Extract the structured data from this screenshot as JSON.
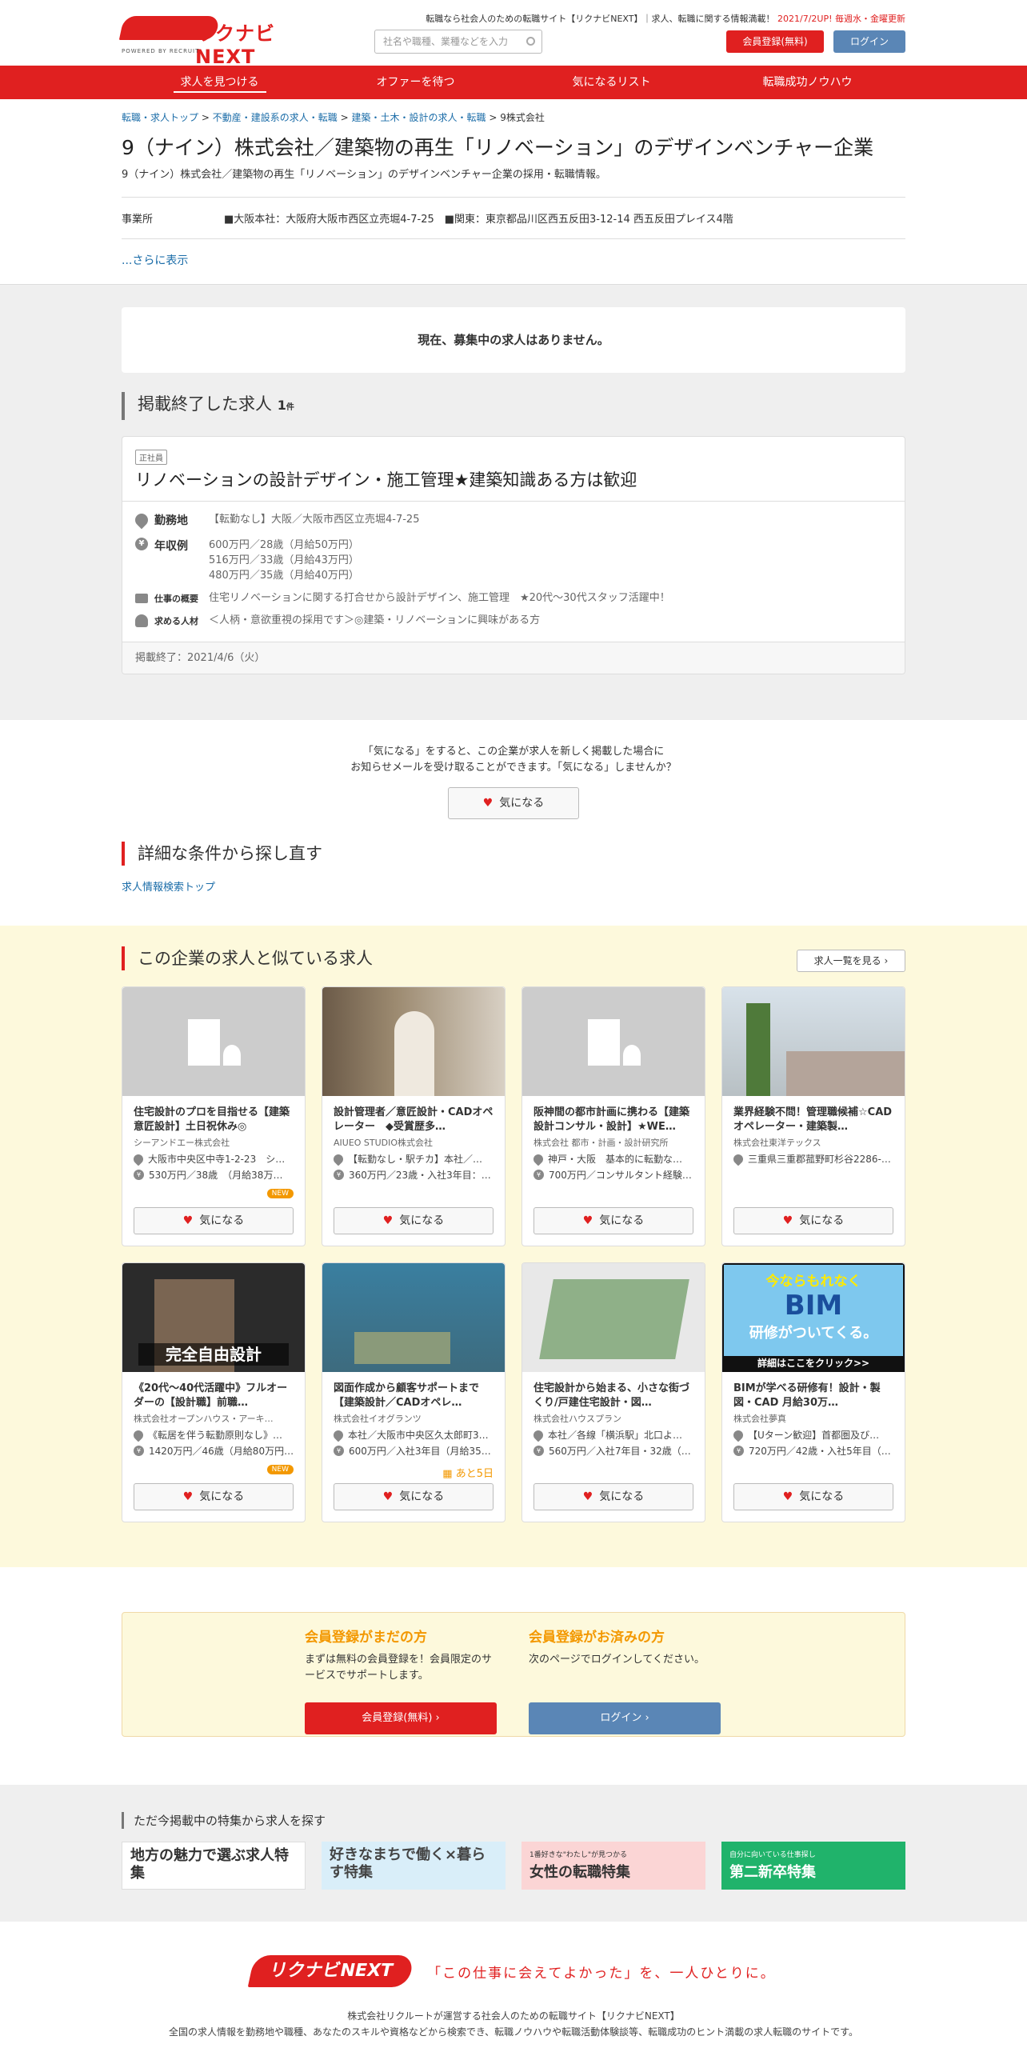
{
  "header": {
    "logo": "リクナビNEXT",
    "powered": "POWERED BY RECRUIT",
    "tagline_pre": "転職なら社会人のための転職サイト【リクナビNEXT】｜求人、転職に関する情報満載！",
    "tagline_red": "2021/7/2UP! 毎週水・金曜更新",
    "search_placeholder": "社名や職種、業種などを入力",
    "register": "会員登録(無料)",
    "login": "ログイン"
  },
  "nav": [
    "求人を見つける",
    "オファーを待つ",
    "気になるリスト",
    "転職成功ノウハウ"
  ],
  "breadcrumb": {
    "c1": "転職・求人トップ",
    "c2": "不動産・建設系の求人・転職",
    "c3": "建築・土木・設計の求人・転職",
    "sep": ">",
    "current": "9株式会社"
  },
  "company": {
    "title": "9（ナイン）株式会社／建築物の再生「リノベーション」のデザインベンチャー企業",
    "subtitle": "9（ナイン）株式会社／建築物の再生「リノベーション」のデザインベンチャー企業の採用・転職情報。",
    "office_label": "事業所",
    "office_value": "■大阪本社：大阪府大阪市西区立売堀4-7-25　■関東：東京都品川区西五反田3-12-14 西五反田プレイス4階",
    "more": "...さらに表示"
  },
  "status": {
    "no_jobs": "現在、募集中の求人はありません。"
  },
  "ended": {
    "heading": "掲載終了した求人",
    "count": "1",
    "count_unit": "件",
    "tag": "正社員",
    "title": "リノベーションの設計デザイン・施工管理★建築知識ある方は歓迎",
    "loc_label": "勤務地",
    "loc": "【転勤なし】大阪／大阪市西区立売堀4-7-25",
    "salary_label": "年収例",
    "salary1": "600万円／28歳（月給50万円）",
    "salary2": "516万円／33歳（月給43万円）",
    "salary3": "480万円／35歳（月給40万円）",
    "summary_label": "仕事の概要",
    "summary": "住宅リノベーションに関する打合せから設計デザイン、施工管理　★20代～30代スタッフ活躍中！",
    "person_label": "求める人材",
    "person": "＜人柄・意欲重視の採用です＞◎建築・リノベーションに興味がある方",
    "end_date": "掲載終了：2021/4/6（火）"
  },
  "kininaru": {
    "text1": "「気になる」をすると、この企業が求人を新しく掲載した場合に",
    "text2": "お知らせメールを受け取ることができます。「気になる」しませんか？",
    "button": "気になる"
  },
  "research": {
    "heading": "詳細な条件から探し直す",
    "link": "求人情報検索トップ"
  },
  "similar": {
    "heading": "この企業の求人と似ている求人",
    "see_all": "求人一覧を見る",
    "kb": "気になる",
    "jobs": [
      {
        "title": "住宅設計のプロを目指せる【建築意匠設計】土日祝休み◎",
        "co": "シーアンドエー株式会社",
        "loc": "大阪市中央区中寺1-2-23　シ…",
        "sal": "530万円／38歳　（月給38万…",
        "badge": "NEW"
      },
      {
        "title": "設計管理者／意匠設計・CADオペレーター　◆受賞歴多…",
        "co": "AIUEO STUDIO株式会社",
        "loc": "【転勤なし・駅チカ】本社／…",
        "sal": "360万円／23歳・入社3年目：…",
        "badge": ""
      },
      {
        "title": "阪神間の都市計画に携わる【建築設計コンサル・設計】★WE…",
        "co": "株式会社 都市・計画・設計研究所",
        "loc": "神戸・大阪　基本的に転勤な…",
        "sal": "700万円／コンサルタント経験…",
        "badge": ""
      },
      {
        "title": "業界経験不問！管理職候補☆CADオペレーター・建築製…",
        "co": "株式会社東洋テックス",
        "loc": "三重県三重郡菰野町杉谷2286-…",
        "sal": "",
        "badge": ""
      },
      {
        "title": "《20代～40代活躍中》フルオーダーの【設計職】前職…",
        "co": "株式会社オープンハウス・アーキ…",
        "loc": "《転居を伴う転勤原則なし》…",
        "sal": "1420万円／46歳（月給80万円…",
        "badge": "NEW"
      },
      {
        "title": "図面作成から顧客サポートまで【建築設計／CADオペレ…",
        "co": "株式会社イオグランツ",
        "loc": "本社／大阪市中央区久太郎町3…",
        "sal": "600万円／入社3年目（月給35…",
        "badge": "あと5日"
      },
      {
        "title": "住宅設計から始まる、小さな街づくり/戸建住宅設計・図…",
        "co": "株式会社ハウスプラン",
        "loc": "本社／各線「横浜駅」北口よ…",
        "sal": "560万円／入社7年目・32歳（…",
        "badge": ""
      },
      {
        "title": "BIMが学べる研修有！設計・製図・CAD 月給30万…",
        "co": "株式会社夢真",
        "loc": "【Uターン歓迎】首都圏及び…",
        "sal": "720万円／42歳・入社5年目（…",
        "badge": ""
      }
    ],
    "img_texts": {
      "design": "完全自由設計",
      "bim1": "今ならもれなく",
      "bim2": "BIM",
      "bim3": "研修がついてくる。",
      "bim4": "詳細はここをクリック>>"
    }
  },
  "member": {
    "h1": "会員登録がまだの方",
    "p1": "まずは無料の会員登録を！会員限定のサービスでサポートします。",
    "b1": "会員登録(無料)",
    "h2": "会員登録がお済みの方",
    "p2": "次のページでログインしてください。",
    "b2": "ログイン"
  },
  "feature": {
    "heading": "ただ今掲載中の特集から求人を探す",
    "b1": "地方の魅力で選ぶ求人特集",
    "b2": "好きなまちで働く×暮らす特集",
    "b3": "女性の転職特集",
    "b3s": "1番好きな\"わたし\"が見つかる",
    "b4": "第二新卒特集",
    "b4s": "自分に向いている仕事探し"
  },
  "footer": {
    "logo": "リクナビNEXT",
    "catch": "「この仕事に会えてよかった」を、一人ひとりに。",
    "l1": "株式会社リクルートが運営する社会人のための転職サイト【リクナビNEXT】",
    "l2": "全国の求人情報を勤務地や職種、あなたのスキルや資格などから検索でき、転職ノウハウや転職活動体験談等、転職成功のヒント満載の求人転職のサイトです。"
  },
  "colors": {
    "brand": "#e02020",
    "accent": "#f39800",
    "link": "#1a6ca8"
  }
}
